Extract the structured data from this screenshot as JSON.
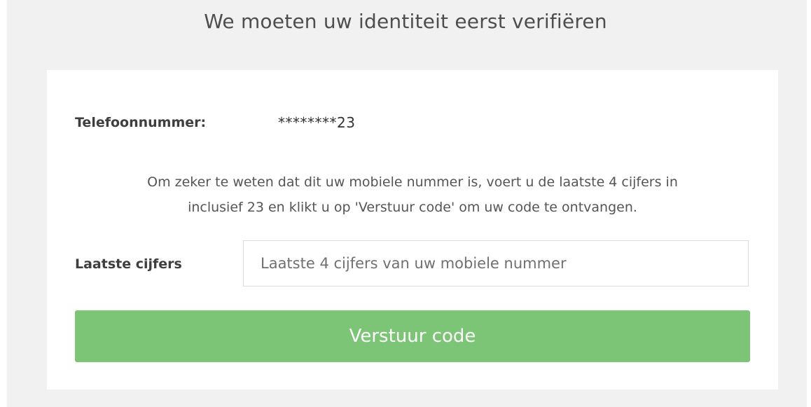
{
  "page": {
    "title": "We moeten uw identiteit eerst verifiëren"
  },
  "verification": {
    "phone_label": "Telefoonnummer:",
    "phone_value": "********23",
    "instruction_line1": "Om zeker te weten dat dit uw mobiele nummer is, voert u de laatste 4 cijfers in",
    "instruction_line2": "inclusief 23 en klikt u op 'Verstuur code' om uw code te ontvangen.",
    "digits_label": "Laatste cijfers",
    "digits_value": "",
    "digits_placeholder": "Laatste 4 cijfers van uw mobiele nummer",
    "send_button_label": "Verstuur code"
  },
  "colors": {
    "background": "#f1f1f1",
    "card": "#ffffff",
    "button": "#7cc576",
    "button_text": "#ffffff"
  }
}
